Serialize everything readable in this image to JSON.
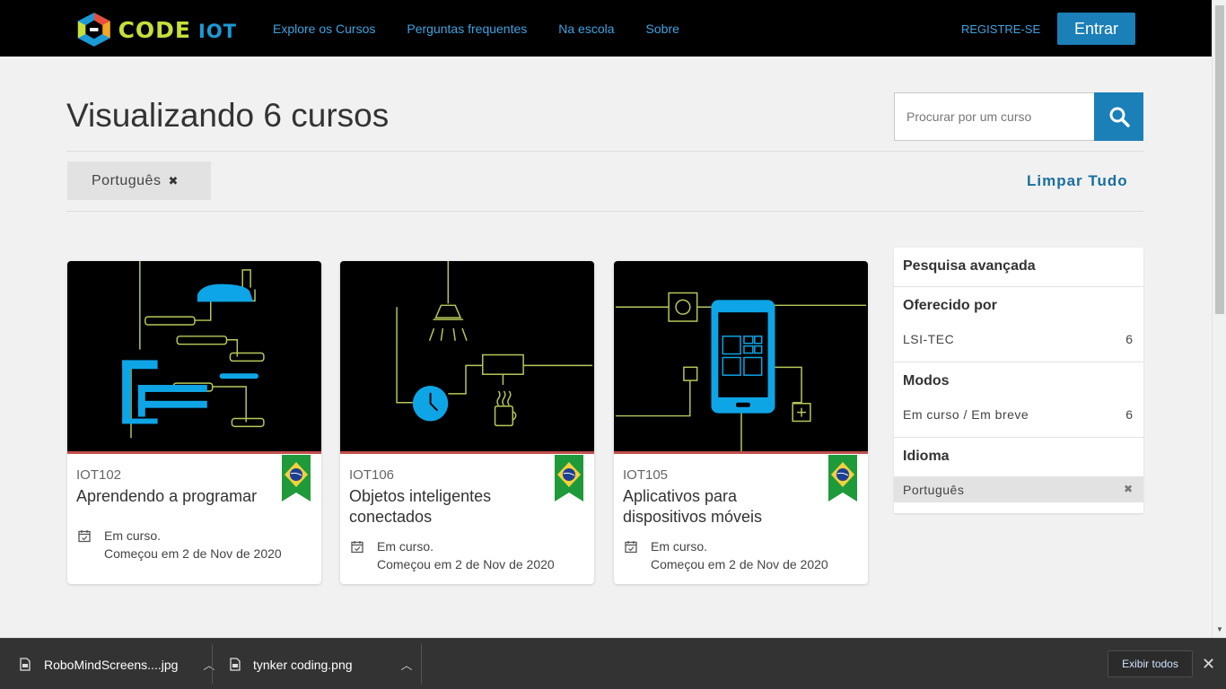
{
  "header": {
    "logo_code": "CODE",
    "logo_iot": "IOT",
    "nav": [
      "Explore os Cursos",
      "Perguntas frequentes",
      "Na escola",
      "Sobre"
    ],
    "register": "REGISTRE-SE",
    "login": "Entrar"
  },
  "main": {
    "title": "Visualizando 6 cursos",
    "search_placeholder": "Procurar por um curso",
    "filter_chip": "Português",
    "clear_all": "Limpar Tudo"
  },
  "courses": [
    {
      "code": "IOT102",
      "title": "Aprendendo a programar",
      "status_line1": "Em curso.",
      "status_line2": "Começou em 2 de Nov de 2020"
    },
    {
      "code": "IOT106",
      "title": "Objetos inteligentes conectados",
      "status_line1": "Em curso.",
      "status_line2": "Começou em 2 de Nov de 2020"
    },
    {
      "code": "IOT105",
      "title": "Aplicativos para dispositivos móveis",
      "status_line1": "Em curso.",
      "status_line2": "Começou em 2 de Nov de 2020"
    }
  ],
  "sidebar": {
    "title": "Pesquisa avançada",
    "offered_by": {
      "heading": "Oferecido por",
      "item": "LSI-TEC",
      "count": "6"
    },
    "modes": {
      "heading": "Modos",
      "item": "Em curso / Em breve",
      "count": "6"
    },
    "language": {
      "heading": "Idioma",
      "item": "Português"
    }
  },
  "downloads": {
    "files": [
      "RoboMindScreens....jpg",
      "tynker coding.png"
    ],
    "show_all": "Exibir todos"
  },
  "colors": {
    "accent": "#1b7fb8",
    "nav_link": "#3da3e0",
    "logo_green": "#c6df3a",
    "logo_blue": "#1b9ad6",
    "card_art_blue": "#0ea5e6",
    "card_art_line": "#b6c95a"
  }
}
